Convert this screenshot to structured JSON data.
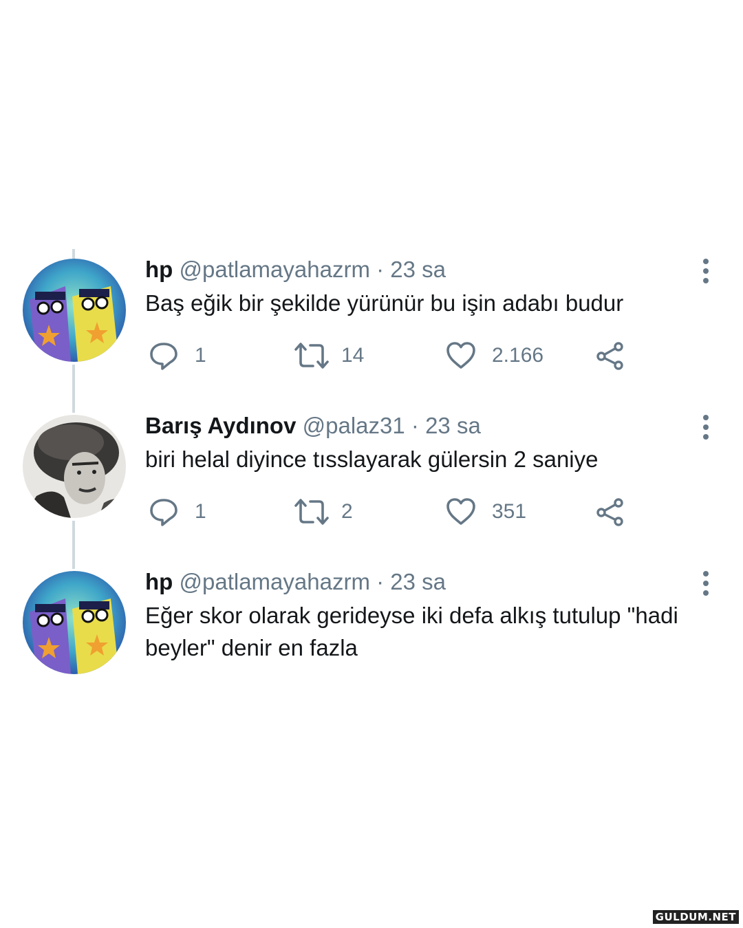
{
  "tweets": [
    {
      "name": "hp",
      "handle": "@patlamayahazrm",
      "separator": "·",
      "time": "23 sa",
      "text": "Baş eğik bir şekilde yürünür bu işin adabı budur",
      "replies": "1",
      "retweets": "14",
      "likes": "2.166"
    },
    {
      "name": "Barış Aydınov",
      "handle": "@palaz31",
      "separator": "·",
      "time": "23 sa",
      "text": "biri helal diyince tısslayarak gülersin 2 saniye",
      "replies": "1",
      "retweets": "2",
      "likes": "351"
    },
    {
      "name": "hp",
      "handle": "@patlamayahazrm",
      "separator": "·",
      "time": "23 sa",
      "text": "Eğer skor olarak gerideyse iki defa alkış tutulup \"hadi beyler\" denir en fazla"
    }
  ],
  "watermark": "GULDUM.NET",
  "icons": [
    "reply-icon",
    "retweet-icon",
    "like-icon",
    "share-icon",
    "more-options-icon"
  ],
  "colors": {
    "text": "#14171a",
    "secondary": "#657786",
    "thread_line": "#cfd9de"
  }
}
